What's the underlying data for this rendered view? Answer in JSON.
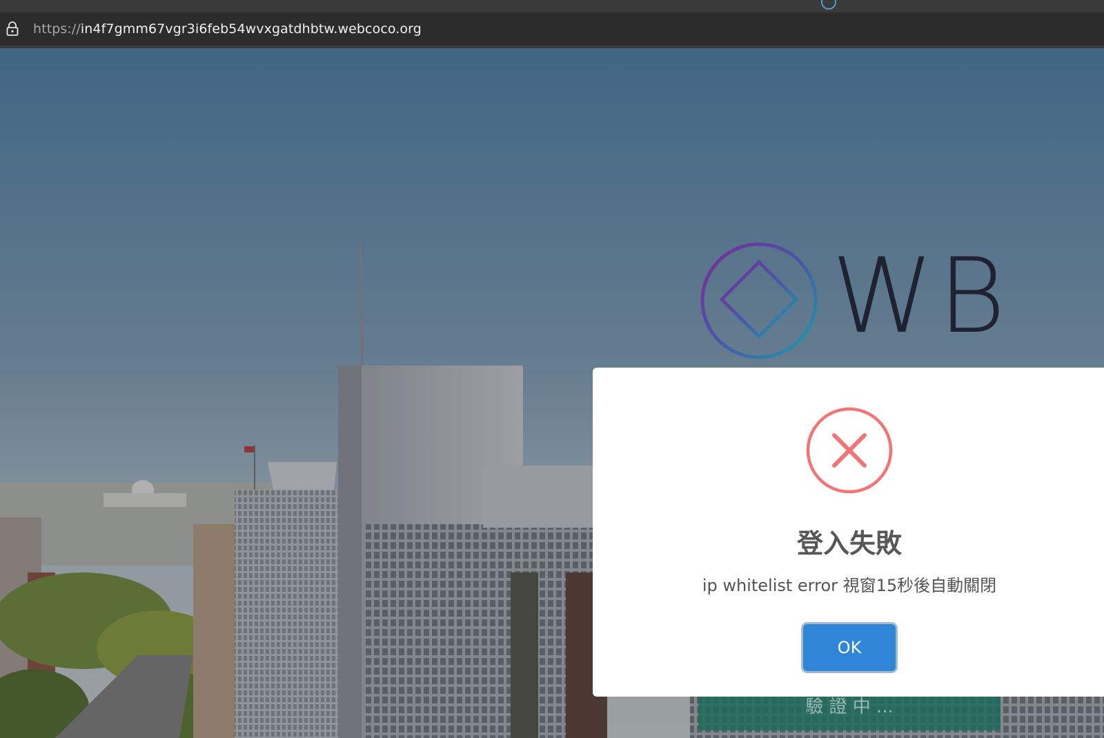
{
  "browser": {
    "url_scheme": "https://",
    "url_host": "in4f7gmm67vgr3i6feb54wvxgatdhbtw.webcoco.org",
    "lock_icon": "lock-icon"
  },
  "page": {
    "logo_text": "WB",
    "logo_icon": "diamond-in-circle-icon",
    "background_button_text": "驗 證 中 ..."
  },
  "dialog": {
    "icon": "error-x-icon",
    "title": "登入失敗",
    "message": "ip whitelist error 視窗15秒後自動關閉",
    "ok_label": "OK",
    "colors": {
      "icon": "#f27474",
      "button": "#3085d6",
      "title": "#575757"
    }
  }
}
